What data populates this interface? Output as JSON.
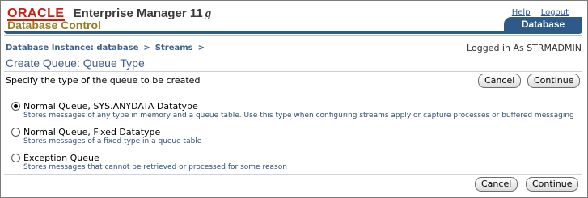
{
  "branding": {
    "vendor": "ORACLE",
    "product": "Enterprise Manager 11",
    "version_suffix": "g",
    "subtitle": "Database Control"
  },
  "global_links": {
    "help": "Help",
    "logout": "Logout"
  },
  "tab": {
    "label": "Database"
  },
  "breadcrumb": {
    "items": [
      "Database Instance: database",
      "Streams"
    ],
    "separator": ">"
  },
  "user_status": "Logged in As STRMADMIN",
  "page": {
    "title": "Create Queue: Queue Type",
    "instructions": "Specify the type of the queue to be created"
  },
  "buttons": {
    "cancel": "Cancel",
    "continue": "Continue"
  },
  "options": [
    {
      "label": "Normal Queue, SYS.ANYDATA Datatype",
      "description": "Stores messages of any type in memory and a queue table. Use this type when configuring streams apply or capture processes or buffered messaging",
      "selected": true
    },
    {
      "label": "Normal Queue, Fixed Datatype",
      "description": "Stores messages of a fixed type in a queue table",
      "selected": false
    },
    {
      "label": "Exception Queue",
      "description": "Stores messages that cannot be retrieved or processed for some reason",
      "selected": false
    }
  ],
  "colors": {
    "brand_red": "#d11c0e",
    "header_blue": "#2e5a8a",
    "link_blue": "#3d5f8f",
    "subtitle_gold": "#9c7b20"
  }
}
